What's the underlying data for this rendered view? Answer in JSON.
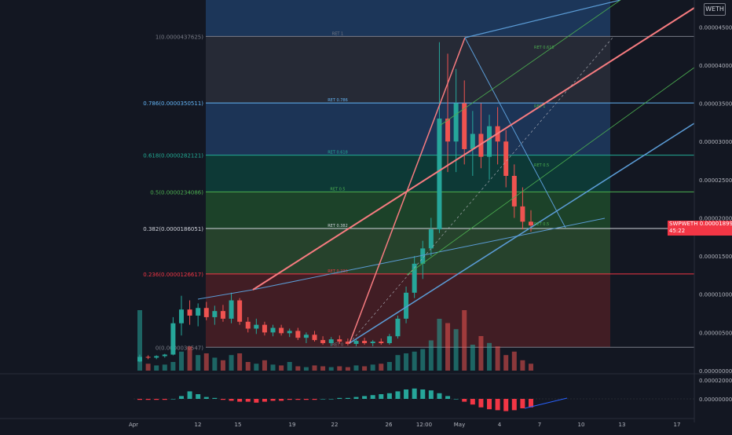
{
  "currency_badge": "WETH",
  "price_tag": {
    "symbol": "SWPWETH",
    "price": "0.0000189991",
    "countdown": "45:22"
  },
  "fib_levels": [
    {
      "ratio": 1,
      "label": "1(0.0000437625)",
      "ret": "RET 1",
      "price": 4.37625e-05,
      "color": "#787b86"
    },
    {
      "ratio": 0.786,
      "label": "0.786(0.0000350511)",
      "ret": "RET 0.786",
      "price": 3.50511e-05,
      "color": "#64b5f6"
    },
    {
      "ratio": 0.618,
      "label": "0.618(0.0000282121)",
      "ret": "RET 0.618",
      "price": 2.82121e-05,
      "color": "#22ab94"
    },
    {
      "ratio": 0.5,
      "label": "0.5(0.0000234086)",
      "ret": "RET 0.5",
      "price": 2.34086e-05,
      "color": "#4caf50"
    },
    {
      "ratio": 0.382,
      "label": "0.382(0.0000186051)",
      "ret": "RET 0.382",
      "price": 1.86051e-05,
      "color": "#d1d4dc"
    },
    {
      "ratio": 0.236,
      "label": "0.236(0.0000126617)",
      "ret": "RET 0.236",
      "price": 1.26617e-05,
      "color": "#f23645"
    },
    {
      "ratio": 0,
      "label": "0(0.0000030547)",
      "ret": "RET 0",
      "price": 3.0547e-06,
      "color": "#787b86"
    }
  ],
  "pitchfork_labels": [
    "RET 0.618",
    "RET 1",
    "RET 0.5",
    "RET 0.5"
  ],
  "chart_data": {
    "type": "candlestick",
    "y_axis_ticks": [
      "0.0000450000",
      "0.0000400000",
      "0.0000350000",
      "0.0000300000",
      "0.0000250000",
      "0.0000200000",
      "0.0000150000",
      "0.0000100000",
      "0.0000050000",
      "0.0000000000"
    ],
    "indicator_ticks": [
      "0.0000200000",
      "0.0000000000"
    ],
    "x_axis_ticks": [
      "Apr",
      "12",
      "15",
      "19",
      "22",
      "26",
      "12:00",
      "May",
      "4",
      "7",
      "10",
      "13",
      "17"
    ],
    "ylim": [
      0,
      4.75e-05
    ],
    "candles_ohlc": [
      [
        1.2e-06,
        2.1e-06,
        1.1e-06,
        1.8e-06
      ],
      [
        1.8e-06,
        2e-06,
        1.5e-06,
        1.7e-06
      ],
      [
        1.7e-06,
        2e-06,
        1.5e-06,
        1.9e-06
      ],
      [
        1.9e-06,
        2.2e-06,
        1.7e-06,
        2.1e-06
      ],
      [
        2.1e-06,
        7e-06,
        2e-06,
        6.2e-06
      ],
      [
        6.2e-06,
        9.8e-06,
        4.6e-06,
        8e-06
      ],
      [
        8e-06,
        9.2e-06,
        6e-06,
        7.2e-06
      ],
      [
        7.2e-06,
        8.8e-06,
        5.8e-06,
        8.2e-06
      ],
      [
        8.2e-06,
        9e-06,
        6.6e-06,
        7e-06
      ],
      [
        7e-06,
        8.5e-06,
        6e-06,
        7.8e-06
      ],
      [
        7.8e-06,
        8.6e-06,
        6.4e-06,
        6.8e-06
      ],
      [
        6.8e-06,
        1.02e-05,
        6.2e-06,
        9.2e-06
      ],
      [
        9.2e-06,
        9.5e-06,
        6e-06,
        6.4e-06
      ],
      [
        6.4e-06,
        7e-06,
        5e-06,
        5.5e-06
      ],
      [
        5.5e-06,
        6.8e-06,
        4.8e-06,
        6e-06
      ],
      [
        6e-06,
        6.4e-06,
        4.6e-06,
        5e-06
      ],
      [
        5e-06,
        6e-06,
        4.5e-06,
        5.6e-06
      ],
      [
        5.6e-06,
        6e-06,
        4.6e-06,
        4.9e-06
      ],
      [
        4.9e-06,
        5.5e-06,
        4.4e-06,
        5.2e-06
      ],
      [
        5.2e-06,
        5.6e-06,
        4e-06,
        4.3e-06
      ],
      [
        4.3e-06,
        5e-06,
        3.6e-06,
        4.7e-06
      ],
      [
        4.7e-06,
        5.2e-06,
        3.8e-06,
        4e-06
      ],
      [
        4e-06,
        4.5e-06,
        3.4e-06,
        3.6e-06
      ],
      [
        3.6e-06,
        4.4e-06,
        3.2e-06,
        4.1e-06
      ],
      [
        4.1e-06,
        4.6e-06,
        3.5e-06,
        3.8e-06
      ],
      [
        3.8e-06,
        4.2e-06,
        3.3e-06,
        3.5e-06
      ],
      [
        3.5e-06,
        4.1e-06,
        3.2e-06,
        3.9e-06
      ],
      [
        3.9e-06,
        4.3e-06,
        3.4e-06,
        3.6e-06
      ],
      [
        3.6e-06,
        4e-06,
        3.2e-06,
        3.8e-06
      ],
      [
        3.8e-06,
        4.2e-06,
        3.4e-06,
        3.6e-06
      ],
      [
        3.6e-06,
        4.8e-06,
        3.4e-06,
        4.5e-06
      ],
      [
        4.5e-06,
        7.2e-06,
        4.2e-06,
        6.8e-06
      ],
      [
        6.8e-06,
        1.1e-05,
        6.2e-06,
        1.02e-05
      ],
      [
        1.02e-05,
        1.5e-05,
        9.5e-06,
        1.4e-05
      ],
      [
        1.4e-05,
        1.7e-05,
        1.2e-05,
        1.6e-05
      ],
      [
        1.6e-05,
        2e-05,
        1.5e-05,
        1.85e-05
      ],
      [
        1.85e-05,
        4.3e-05,
        1.8e-05,
        3.3e-05
      ],
      [
        3.3e-05,
        4.15e-05,
        2.6e-05,
        3e-05
      ],
      [
        3e-05,
        3.95e-05,
        2.6e-05,
        3.5e-05
      ],
      [
        3.5e-05,
        3.8e-05,
        2.7e-05,
        2.9e-05
      ],
      [
        2.9e-05,
        3.4e-05,
        2.55e-05,
        3.1e-05
      ],
      [
        3.1e-05,
        3.5e-05,
        2.65e-05,
        2.8e-05
      ],
      [
        2.8e-05,
        3.35e-05,
        2.5e-05,
        3.2e-05
      ],
      [
        3.2e-05,
        3.45e-05,
        2.7e-05,
        3e-05
      ],
      [
        3e-05,
        3.15e-05,
        2.4e-05,
        2.55e-05
      ],
      [
        2.55e-05,
        2.7e-05,
        2e-05,
        2.15e-05
      ],
      [
        2.15e-05,
        2.4e-05,
        1.85e-05,
        1.95e-05
      ],
      [
        1.95e-05,
        2.1e-05,
        1.82e-05,
        1.9e-05
      ]
    ],
    "volume": [
      0.7,
      0.08,
      0.06,
      0.07,
      0.1,
      0.22,
      0.28,
      0.18,
      0.2,
      0.15,
      0.12,
      0.18,
      0.2,
      0.1,
      0.08,
      0.12,
      0.07,
      0.06,
      0.1,
      0.05,
      0.04,
      0.06,
      0.05,
      0.04,
      0.05,
      0.04,
      0.06,
      0.05,
      0.07,
      0.08,
      0.1,
      0.18,
      0.2,
      0.22,
      0.25,
      0.35,
      0.6,
      0.55,
      0.48,
      0.7,
      0.3,
      0.4,
      0.32,
      0.28,
      0.18,
      0.22,
      0.12,
      0.08
    ],
    "histogram": [
      -0.1,
      -0.1,
      -0.1,
      -0.1,
      0,
      0.3,
      0.8,
      0.5,
      0.2,
      0.1,
      -0.1,
      -0.2,
      -0.3,
      -0.3,
      -0.4,
      -0.3,
      -0.2,
      -0.2,
      -0.1,
      -0.1,
      -0.1,
      -0.1,
      0,
      0,
      0.1,
      0.1,
      0.2,
      0.3,
      0.4,
      0.5,
      0.6,
      0.8,
      1.0,
      1.1,
      1.0,
      0.9,
      0.6,
      0.3,
      0,
      -0.3,
      -0.6,
      -0.9,
      -1.1,
      -1.2,
      -1.3,
      -1.2,
      -1.0,
      -0.9
    ]
  }
}
